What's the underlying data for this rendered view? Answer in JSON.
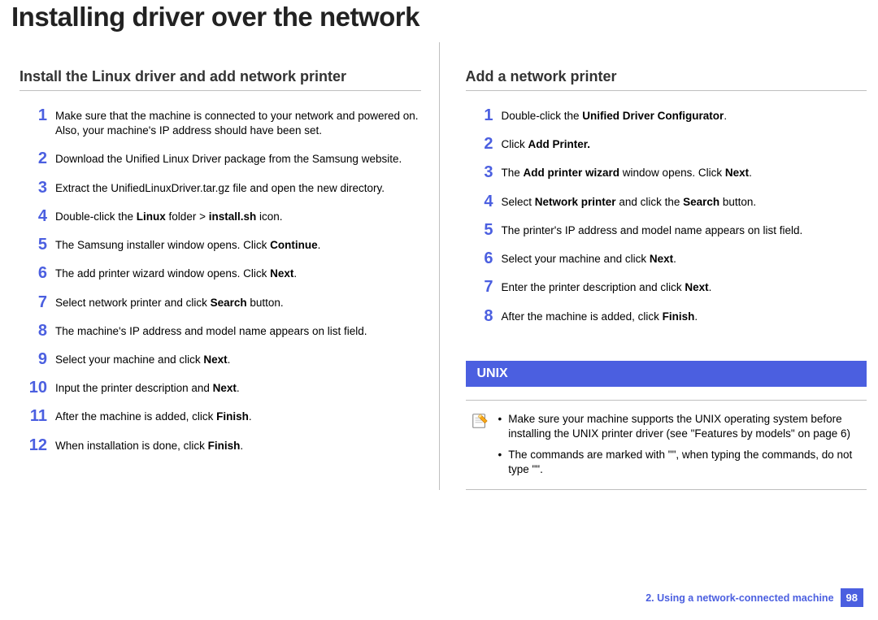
{
  "title": "Installing driver over the network",
  "left": {
    "heading": "Install the Linux driver and add network printer",
    "steps": [
      {
        "n": "1",
        "html": "Make sure that the machine is connected to your network and powered on. Also, your machine's IP address should have been set."
      },
      {
        "n": "2",
        "html": "Download the Unified Linux Driver package from the Samsung website."
      },
      {
        "n": "3",
        "html": "Extract the UnifiedLinuxDriver.tar.gz file and open the new directory."
      },
      {
        "n": "4",
        "html": "Double-click the <b>Linux</b> folder > <b>install.sh</b> icon."
      },
      {
        "n": "5",
        "html": "The Samsung installer window opens. Click <b>Continue</b>."
      },
      {
        "n": "6",
        "html": "The add printer wizard window opens. Click <b>Next</b>."
      },
      {
        "n": "7",
        "html": "Select network printer and click <b>Search</b> button."
      },
      {
        "n": "8",
        "html": "The machine's IP address and model name appears on list field."
      },
      {
        "n": "9",
        "html": "Select your machine and click <b>Next</b>."
      },
      {
        "n": "10",
        "html": "Input the printer description and <b>Next</b>."
      },
      {
        "n": "11",
        "html": "After the machine is added, click <b>Finish</b>."
      },
      {
        "n": "12",
        "html": "When installation is done, click <b>Finish</b>."
      }
    ]
  },
  "right": {
    "heading": "Add a network printer",
    "steps": [
      {
        "n": "1",
        "html": "Double-click the <b>Unified Driver Configurator</b>."
      },
      {
        "n": "2",
        "html": "Click <b>Add Printer.</b>"
      },
      {
        "n": "3",
        "html": "The <b>Add printer wizard</b> window opens. Click <b>Next</b>."
      },
      {
        "n": "4",
        "html": "Select <b>Network printer</b> and click the <b>Search</b> button."
      },
      {
        "n": "5",
        "html": "The printer's IP address and model name appears on list field."
      },
      {
        "n": "6",
        "html": "Select your machine and click <b>Next</b>."
      },
      {
        "n": "7",
        "html": "Enter the printer description and click <b>Next</b>."
      },
      {
        "n": "8",
        "html": "After the machine is added, click <b>Finish</b>."
      }
    ],
    "band": "UNIX",
    "note": {
      "bullets": [
        "Make sure your machine supports the UNIX operating system before installing the UNIX printer driver (see \"Features by models\" on page 6)",
        "The commands are marked with \"\", when typing the commands, do not type \"\"."
      ]
    }
  },
  "footer": {
    "chapter": "2.  Using a network-connected machine",
    "page": "98"
  }
}
